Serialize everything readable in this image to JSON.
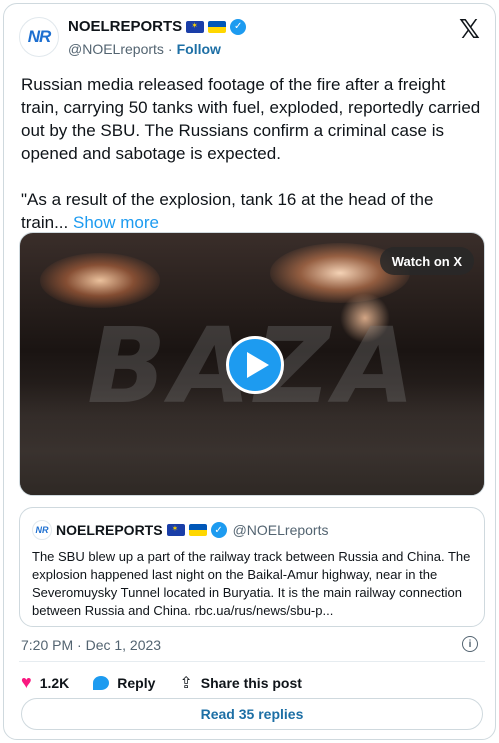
{
  "author": {
    "avatar_text": "NR",
    "name": "NOELREPORTS",
    "handle": "@NOELreports",
    "separator": "·",
    "follow_label": "Follow"
  },
  "x_logo": "𝕏",
  "tweet": {
    "paragraph1": "Russian media released footage of the fire after a freight train, carrying 50 tanks with fuel, exploded, reportedly carried out by the SBU. The Russians confirm a criminal case is opened and sabotage is expected.",
    "paragraph2": "\"As a result of the explosion, tank 16 at the head of the train...",
    "show_more_label": "Show more"
  },
  "media": {
    "watermark": "BAZA",
    "watch_label": "Watch on X",
    "play_icon": "play-icon"
  },
  "quote": {
    "avatar_text": "NR",
    "name": "NOELREPORTS",
    "handle": "@NOELreports",
    "text": "The SBU blew up a part of the railway track between Russia and China. The explosion happened last night on the Baikal-Amur highway, near in the Severomuysky Tunnel located in Buryatia. It is the main railway connection between Russia and China. rbc.ua/rus/news/sbu-p..."
  },
  "timestamp": "7:20 PM · Dec 1, 2023",
  "actions": {
    "likes": "1.2K",
    "reply_label": "Reply",
    "share_label": "Share this post"
  },
  "read_replies_label": "Read 35 replies",
  "colors": {
    "accent": "#1d9bf0",
    "link": "#1d6fa5",
    "like": "#f91880",
    "muted": "#536471"
  }
}
